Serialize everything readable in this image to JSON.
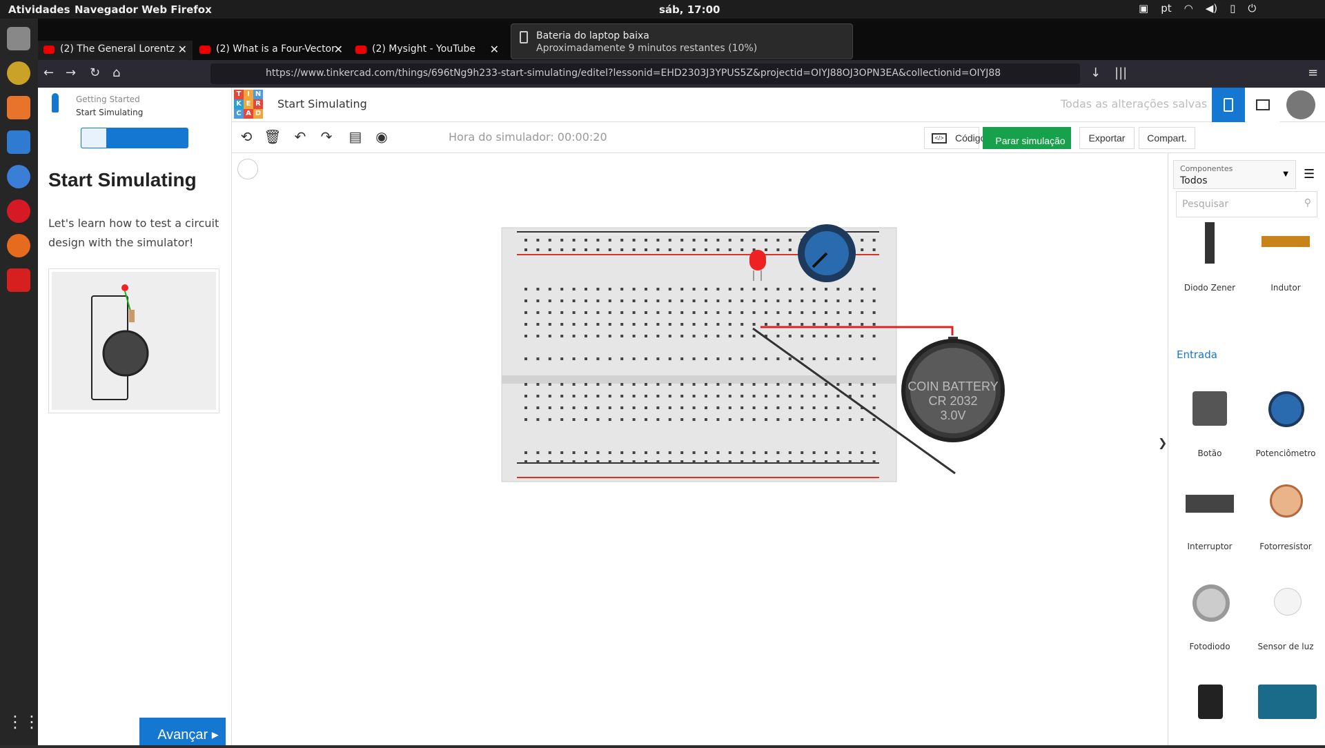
{
  "os": {
    "activities": "Atividades",
    "app_menu": "Navegador Web Firefox",
    "clock": "sáb, 17:00",
    "lang": "pt"
  },
  "tabs": [
    {
      "label": "(2) The General Lorentz"
    },
    {
      "label": "(2) What is a Four-Vector"
    },
    {
      "label": "(2) Mysight - YouTube"
    }
  ],
  "notification": {
    "title": "Bateria do laptop baixa",
    "message": "Aproximadamente 9 minutos restantes (10%)"
  },
  "url": "https://www.tinkercad.com/things/696tNg9h233-start-simulating/editel?lessonid=EHD2303J3YPUS5Z&projectid=OIYJ88OJ3OPN3EA&collectionid=OIYJ88",
  "lesson": {
    "crumb_top": "Getting Started",
    "crumb_sub": "Start Simulating",
    "title": "Start Simulating",
    "body": "Let's learn how to test a circuit design with the simulator!",
    "next": "Avançar"
  },
  "header": {
    "title": "Start Simulating",
    "saved": "Todas as alterações salvas"
  },
  "toolbar": {
    "timer": "Hora do simulador: 00:00:20",
    "code": "Código",
    "stop": "Parar simulação",
    "export": "Exportar",
    "share": "Compart."
  },
  "battery_label": {
    "l1": "COIN BATTERY",
    "l2": "CR 2032",
    "l3": "3.0V"
  },
  "panel": {
    "select_label": "Componentes",
    "select_value": "Todos",
    "search_placeholder": "Pesquisar",
    "section": "Entrada"
  },
  "components": [
    {
      "label": "Diodo Zener"
    },
    {
      "label": "Indutor"
    },
    {
      "label": "Botão"
    },
    {
      "label": "Potenciômetro"
    },
    {
      "label": "Interruptor"
    },
    {
      "label": "Fotorresistor"
    },
    {
      "label": "Fotodiodo"
    },
    {
      "label": "Sensor de luz"
    }
  ],
  "colors": {
    "accent": "#1477d1",
    "stop": "#17a14b"
  }
}
